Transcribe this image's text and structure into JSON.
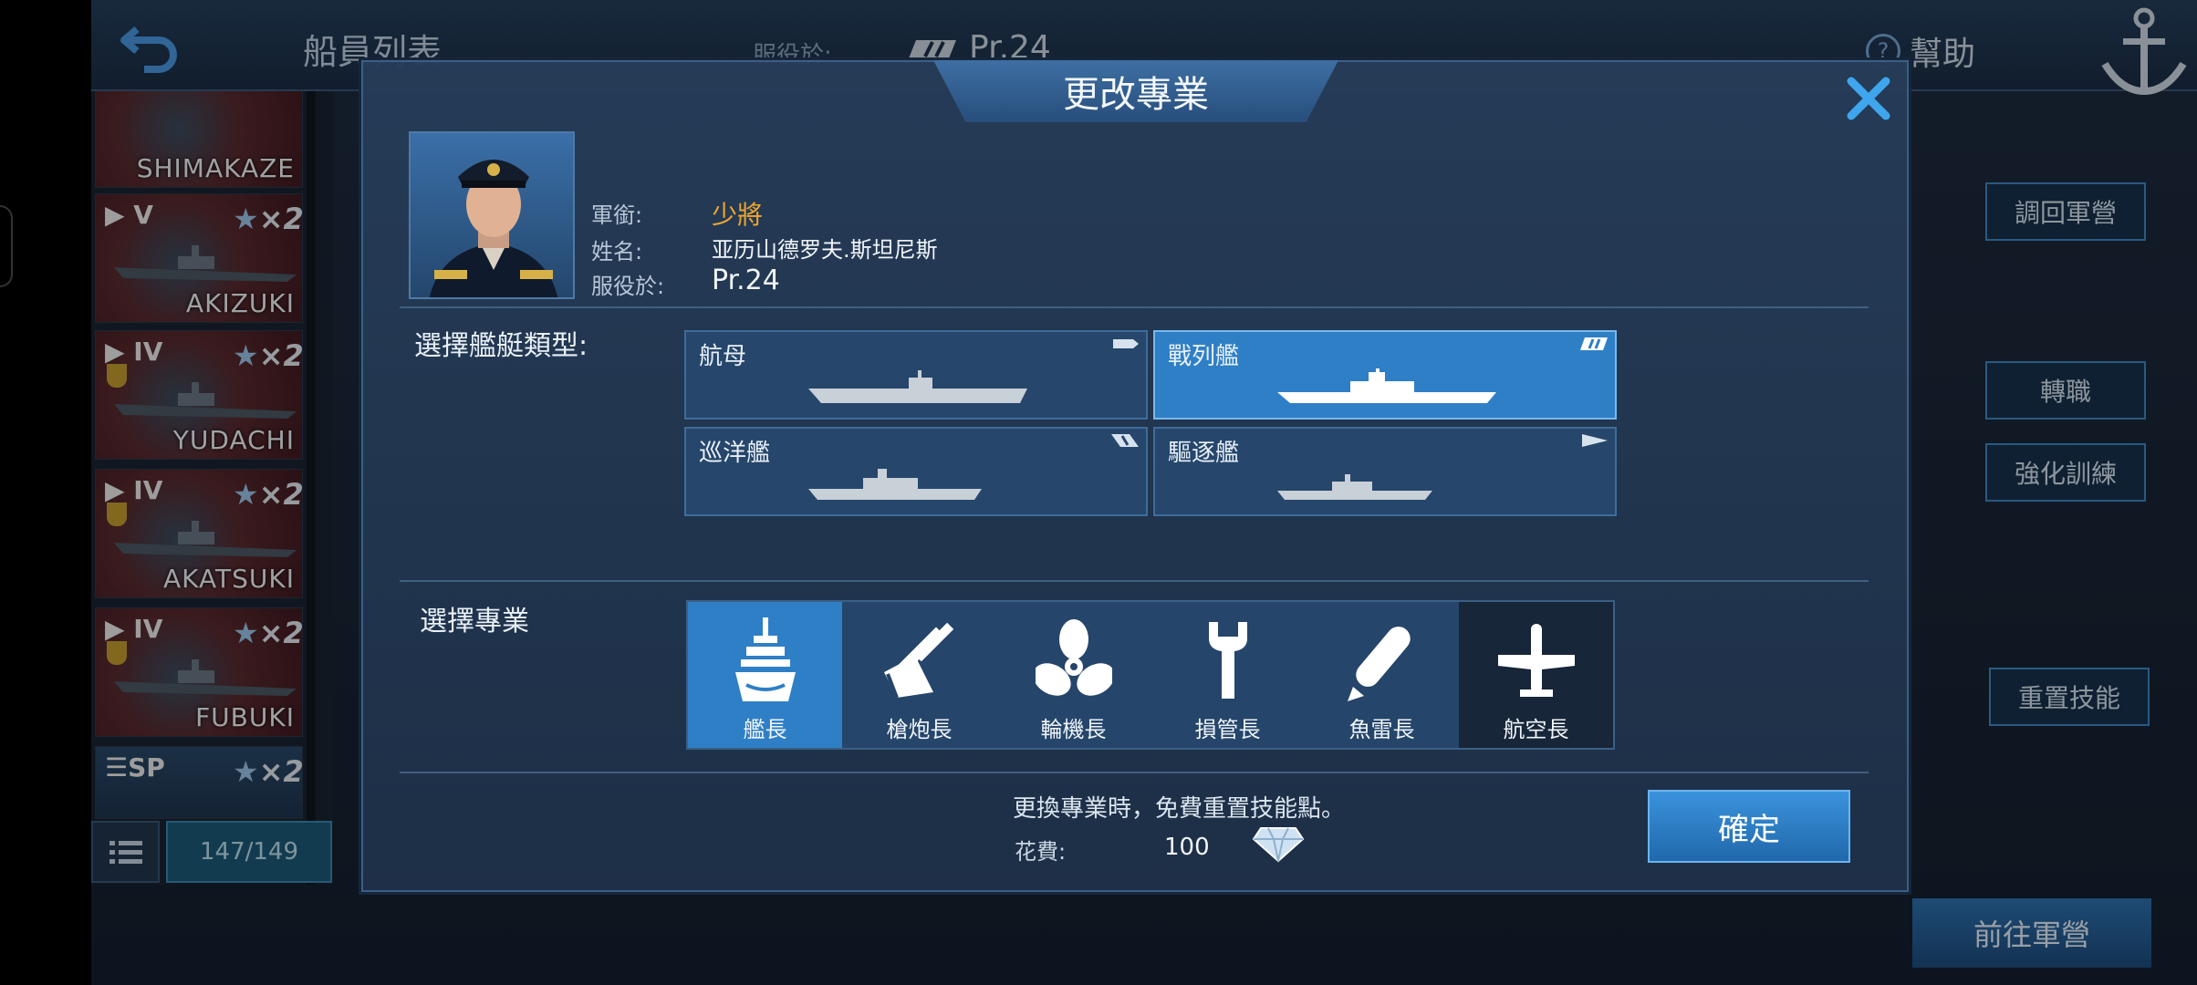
{
  "topbar": {
    "title": "船員列表",
    "serve_label": "服役於:",
    "serve_value": "Pr.24",
    "help_label": "幫助"
  },
  "ship_list": {
    "items": [
      {
        "tier": "",
        "name": "SHIMAKAZE",
        "mult": ""
      },
      {
        "tier": "V",
        "name": "AKIZUKI",
        "mult": "×2"
      },
      {
        "tier": "IV",
        "name": "YUDACHI",
        "mult": "×2"
      },
      {
        "tier": "IV",
        "name": "AKATSUKI",
        "mult": "×2"
      },
      {
        "tier": "IV",
        "name": "FUBUKI",
        "mult": "×2"
      },
      {
        "tier": "SP",
        "name": "",
        "mult": "×2"
      }
    ],
    "count": "147/149"
  },
  "background_buttons": {
    "recall": "調回軍營",
    "transfer": "轉職",
    "training": "強化訓練",
    "reset_skill": "重置技能",
    "goto_barracks": "前往軍營"
  },
  "modal": {
    "title": "更改專業",
    "rank_label": "軍銜:",
    "rank_value": "少將",
    "name_label": "姓名:",
    "name_value": "亚历山德罗夫.斯坦尼斯",
    "serve_label": "服役於:",
    "serve_value": "Pr.24",
    "ship_type_label": "選擇艦艇類型:",
    "ship_types": [
      {
        "label": "航母",
        "selected": false
      },
      {
        "label": "戰列艦",
        "selected": true
      },
      {
        "label": "巡洋艦",
        "selected": false
      },
      {
        "label": "驅逐艦",
        "selected": false
      }
    ],
    "specialty_label": "選擇專業",
    "specialties": [
      {
        "label": "艦長",
        "icon": "captain-ship-icon",
        "selected": true
      },
      {
        "label": "槍炮長",
        "icon": "gun-turret-icon",
        "selected": false
      },
      {
        "label": "輪機長",
        "icon": "propeller-icon",
        "selected": false
      },
      {
        "label": "損管長",
        "icon": "wrench-icon",
        "selected": false
      },
      {
        "label": "魚雷長",
        "icon": "torpedo-icon",
        "selected": false
      },
      {
        "label": "航空長",
        "icon": "airplane-icon",
        "selected": false
      }
    ],
    "notice": "更換專業時，免費重置技能點。",
    "cost_label": "花費:",
    "cost_value": "100",
    "cost_icon": "diamond-icon",
    "confirm_label": "確定"
  },
  "colors": {
    "accent_blue": "#2f7fc6",
    "rank_gold": "#f0a62e",
    "close_blue": "#3fa6ee"
  }
}
